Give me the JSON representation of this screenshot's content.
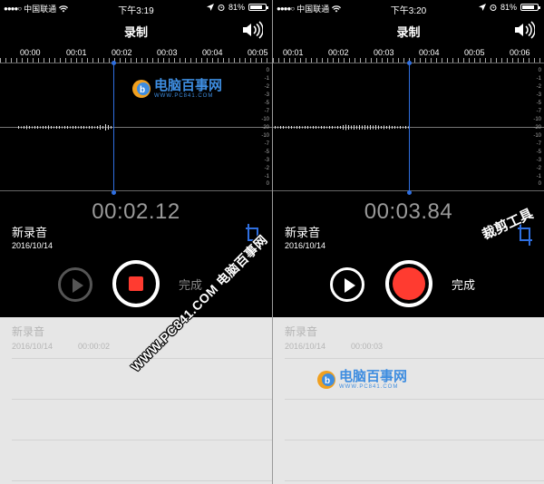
{
  "status_bar": {
    "signal": "●●●●○",
    "carrier": "中国联通",
    "battery": "81%",
    "battery_level": 0.81
  },
  "left": {
    "status_time": "下午3:19",
    "title": "录制",
    "ticks": [
      "00:00",
      "00:01",
      "00:02",
      "00:03",
      "00:04",
      "00:05"
    ],
    "db_labels": [
      "0",
      "-1",
      "-2",
      "-3",
      "-5",
      "-7",
      "-10",
      "-20",
      "-10",
      "-7",
      "-5",
      "-3",
      "-2",
      "-1",
      "0"
    ],
    "current_time": "00:02.12",
    "recording_name": "新录音",
    "recording_date": "2016/10/14",
    "done_label": "完成",
    "list_item": {
      "name": "新录音",
      "date": "2016/10/14",
      "duration": "00:00:02"
    }
  },
  "right": {
    "status_time": "下午3:20",
    "title": "录制",
    "ticks": [
      "00:01",
      "00:02",
      "00:03",
      "00:04",
      "00:05",
      "00:06"
    ],
    "db_labels": [
      "0",
      "-1",
      "-2",
      "-3",
      "-5",
      "-7",
      "-10",
      "-20",
      "-10",
      "-7",
      "-5",
      "-3",
      "-2",
      "-1",
      "0"
    ],
    "current_time": "00:03.84",
    "recording_name": "新录音",
    "recording_date": "2016/10/14",
    "done_label": "完成",
    "list_item": {
      "name": "新录音",
      "date": "2016/10/14",
      "duration": "00:00:03"
    }
  },
  "watermarks": {
    "site_name": "电脑百事网",
    "site_url": "WWW.PC841.COM",
    "diagonal_text": "WWW.PC841.COM 电脑百事网",
    "crop_tool_label": "裁剪工具"
  },
  "colors": {
    "accent_blue": "#2f6fe0",
    "record_red": "#ff3b30",
    "list_background": "#e6e6e6"
  }
}
